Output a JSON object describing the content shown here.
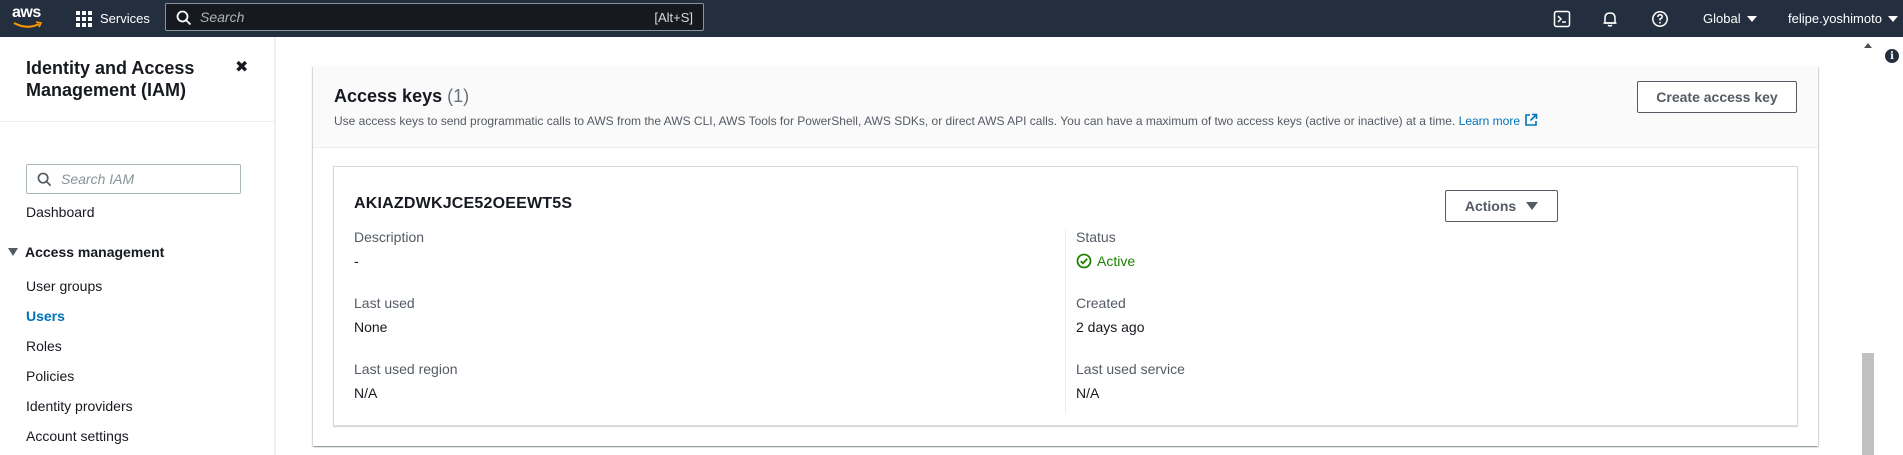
{
  "topnav": {
    "logo_text": "aws",
    "services_label": "Services",
    "search_placeholder": "Search",
    "search_shortcut": "[Alt+S]",
    "region_label": "Global",
    "user_label": "felipe.yoshimoto"
  },
  "sidebar": {
    "title": "Identity and Access Management (IAM)",
    "close_glyph": "✖",
    "search_placeholder": "Search IAM",
    "dashboard_label": "Dashboard",
    "section_label": "Access management",
    "items": [
      {
        "label": "User groups"
      },
      {
        "label": "Users",
        "active": true
      },
      {
        "label": "Roles"
      },
      {
        "label": "Policies"
      },
      {
        "label": "Identity providers"
      },
      {
        "label": "Account settings"
      }
    ]
  },
  "access_keys": {
    "title": "Access keys",
    "count": "(1)",
    "description": "Use access keys to send programmatic calls to AWS from the AWS CLI, AWS Tools for PowerShell, AWS SDKs, or direct AWS API calls. You can have a maximum of two access keys (active or inactive) at a time.",
    "learn_more": "Learn more",
    "create_button": "Create access key",
    "key": {
      "id": "AKIAZDWKJCE52OEEWT5S",
      "actions_button": "Actions",
      "description_label": "Description",
      "description_value": "-",
      "status_label": "Status",
      "status_value": "Active",
      "last_used_label": "Last used",
      "last_used_value": "None",
      "created_label": "Created",
      "created_value": "2 days ago",
      "last_used_region_label": "Last used region",
      "last_used_region_value": "N/A",
      "last_used_service_label": "Last used service",
      "last_used_service_value": "N/A"
    }
  },
  "colors": {
    "nav_bg": "#232f3e",
    "link": "#0073bb",
    "success": "#1d8102"
  }
}
